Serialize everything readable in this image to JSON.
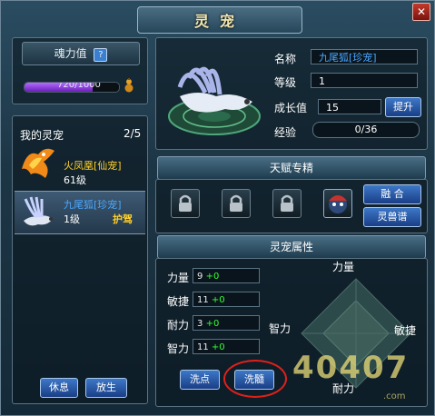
{
  "window": {
    "title": "灵宠",
    "close": "✕"
  },
  "soul": {
    "label": "魂力值",
    "help": "?",
    "value": "720/1000",
    "fill": 0.72
  },
  "pet_list": {
    "title": "我的灵宠",
    "count": "2/5",
    "items": [
      {
        "name": "火凤凰[仙宠]",
        "level": "61级",
        "tag": "",
        "name_color": "#ffd02a"
      },
      {
        "name": "九尾狐[珍宠]",
        "level": "1级",
        "tag": "护驾",
        "name_color": "#4aa8ff"
      }
    ],
    "rest_button": "休息",
    "release_button": "放生"
  },
  "info": {
    "name_label": "名称",
    "name_value": "九尾狐[珍宠]",
    "level_label": "等级",
    "level_value": "1",
    "growth_label": "成长值",
    "growth_value": "15",
    "upgrade_button": "提升",
    "exp_label": "经验",
    "exp_value": "0/36",
    "exp_fill": 0.0
  },
  "talent": {
    "title": "天赋专精",
    "fuse_button": "融 合",
    "beast_button": "灵兽谱"
  },
  "attributes": {
    "title": "灵宠属性",
    "stats": [
      {
        "label": "力量",
        "value": "9",
        "bonus": "+0"
      },
      {
        "label": "敏捷",
        "value": "11",
        "bonus": "+0"
      },
      {
        "label": "耐力",
        "value": "3",
        "bonus": "+0"
      },
      {
        "label": "智力",
        "value": "11",
        "bonus": "+0"
      }
    ],
    "wash_button": "洗点",
    "marrow_button": "洗髓",
    "radar": {
      "top": "力量",
      "left": "智力",
      "right": "敏捷",
      "bottom": "耐力"
    }
  },
  "watermark": {
    "text": "40407",
    "suffix": ".com"
  },
  "colors": {
    "plus": "#33ff33",
    "highlight_circle": "#e0201a"
  }
}
